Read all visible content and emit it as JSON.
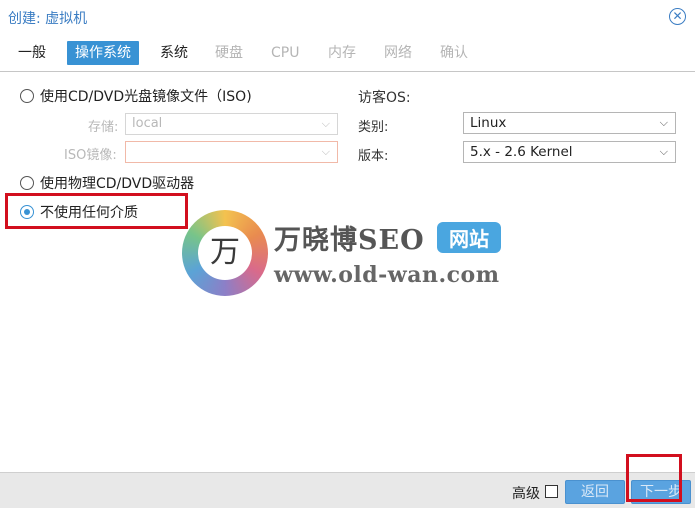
{
  "window": {
    "title": "创建: 虚拟机",
    "close_icon": "close-icon"
  },
  "tabs": [
    {
      "label": "一般",
      "state": "normal"
    },
    {
      "label": "操作系统",
      "state": "active"
    },
    {
      "label": "系统",
      "state": "normal"
    },
    {
      "label": "硬盘",
      "state": "disabled"
    },
    {
      "label": "CPU",
      "state": "disabled"
    },
    {
      "label": "内存",
      "state": "disabled"
    },
    {
      "label": "网络",
      "state": "disabled"
    },
    {
      "label": "确认",
      "state": "disabled"
    }
  ],
  "media": {
    "option_iso": "使用CD/DVD光盘镜像文件（ISO)",
    "storage_label": "存储:",
    "storage_value": "local",
    "iso_label": "ISO镜像:",
    "iso_value": "",
    "option_physical": "使用物理CD/DVD驱动器",
    "option_none": "不使用任何介质",
    "selected": "option_none"
  },
  "guest_os": {
    "heading": "访客OS:",
    "type_label": "类别:",
    "type_value": "Linux",
    "version_label": "版本:",
    "version_value": "5.x - 2.6 Kernel"
  },
  "watermark": {
    "logo_char": "万",
    "name": "万晓博SEO",
    "badge": "网站",
    "url": "www.old-wan.com"
  },
  "footer": {
    "advanced_label": "高级",
    "advanced_checked": false,
    "back_label": "返回",
    "next_label": "下一步"
  },
  "colors": {
    "accent": "#3892d4",
    "highlight_box": "#d20f1e",
    "title": "#3b7dc3"
  }
}
